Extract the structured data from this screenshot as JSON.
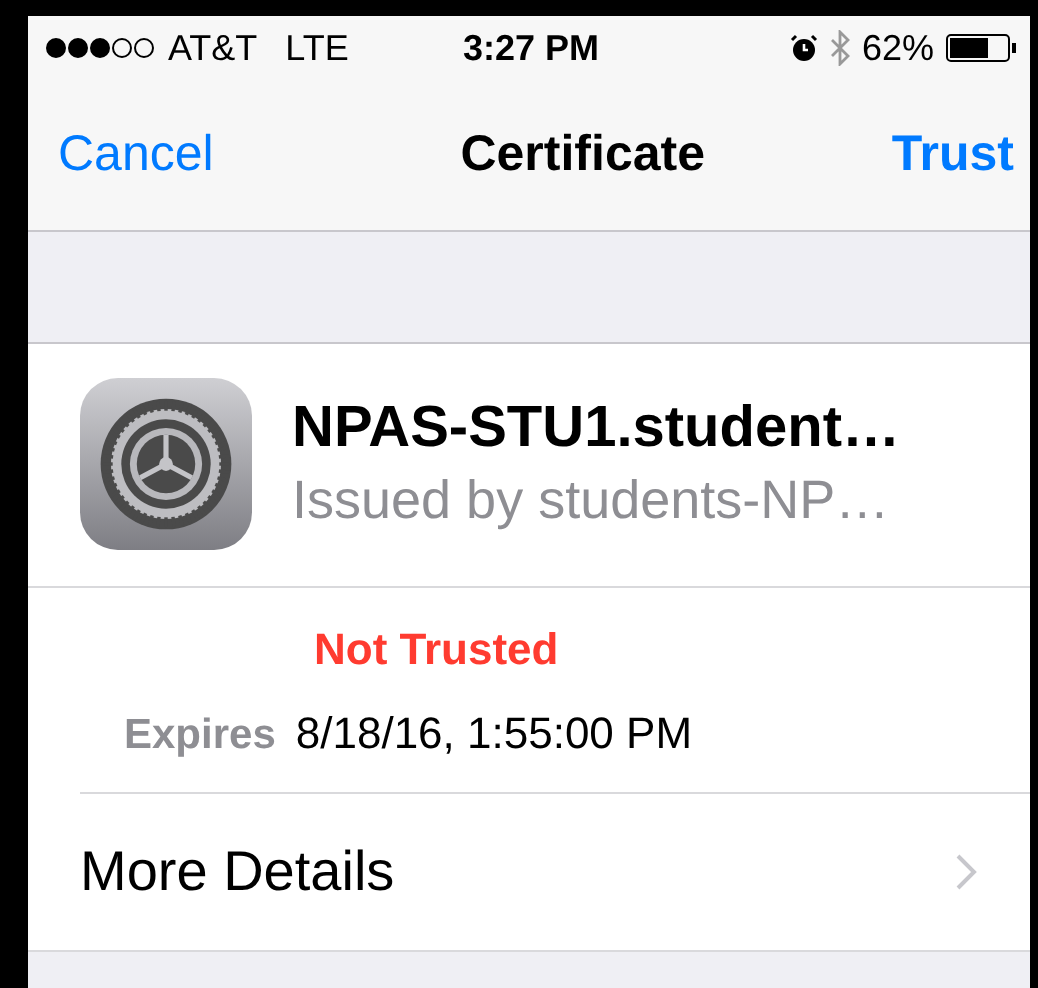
{
  "status_bar": {
    "carrier": "AT&T",
    "network": "LTE",
    "time": "3:27 PM",
    "battery": "62%"
  },
  "nav_bar": {
    "left": "Cancel",
    "title": "Certificate",
    "right": "Trust"
  },
  "certificate": {
    "name": "NPAS-STU1.student…",
    "issuer": "Issued by students-NP…",
    "status": "Not Trusted",
    "expires_label": "Expires",
    "expires_value": "8/18/16, 1:55:00 PM"
  },
  "rows": [
    {
      "label": "More Details"
    }
  ]
}
